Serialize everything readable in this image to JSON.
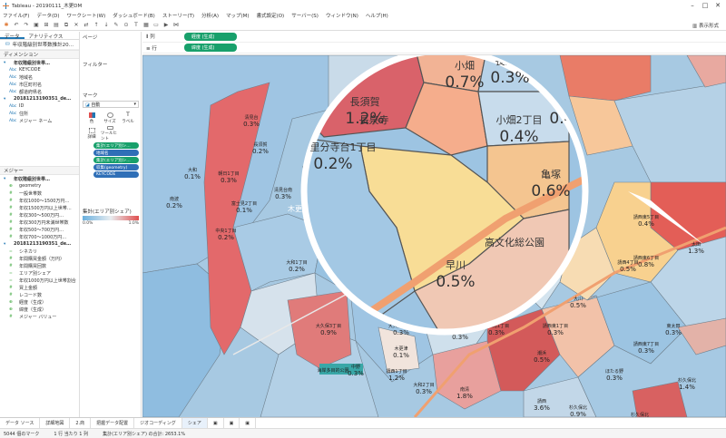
{
  "app": {
    "title": "Tableau - 20190111_木更DM"
  },
  "menu": [
    "ファイル(F)",
    "データ(D)",
    "ワークシート(W)",
    "ダッシュボード(B)",
    "ストーリー(T)",
    "分析(A)",
    "マップ(M)",
    "書式設定(O)",
    "サーバー(S)",
    "ウィンドウ(N)",
    "ヘルプ(H)"
  ],
  "toolbar": {
    "show_me": "表示形式"
  },
  "sidebar": {
    "tabs": [
      "データ",
      "アナリティクス"
    ],
    "datasource": "年収階級別世帯数推計20…",
    "dimensions_label": "ディメンション",
    "dim_groups": [
      {
        "name": "年収階級別世帯…",
        "fields": [
          {
            "icon": "Abc",
            "label": "KEYCODE"
          },
          {
            "icon": "Abc",
            "label": "地域名"
          },
          {
            "icon": "Abc",
            "label": "市区町村名"
          },
          {
            "icon": "Abc",
            "label": "都道府県名"
          }
        ]
      },
      {
        "name": "20181213190351_de…",
        "fields": [
          {
            "icon": "Abc",
            "label": "ID"
          },
          {
            "icon": "Abc",
            "label": "住所"
          },
          {
            "icon": "Abc",
            "label": "メジャー ネーム"
          }
        ]
      }
    ],
    "measures_label": "メジャー",
    "meas_groups": [
      {
        "name": "年収階級別世帯…",
        "fields": [
          {
            "icon": "⊕",
            "label": "geometry"
          },
          {
            "icon": "#",
            "label": "一般世帯数"
          },
          {
            "icon": "#",
            "label": "年収1000～1500万円…"
          },
          {
            "icon": "#",
            "label": "年収1500万円以上世帯…"
          },
          {
            "icon": "#",
            "label": "年収300～500万円…"
          },
          {
            "icon": "#",
            "label": "年収300万円未満世帯数"
          },
          {
            "icon": "#",
            "label": "年収500～700万円…"
          },
          {
            "icon": "#",
            "label": "年収700～1000万円…"
          }
        ]
      },
      {
        "name": "20181213190351_de…",
        "fields": [
          {
            "icon": "=",
            "label": "シネカリ"
          },
          {
            "icon": "#",
            "label": "年間購買金額（万円）"
          },
          {
            "icon": "#",
            "label": "年間購買回数"
          }
        ]
      },
      {
        "name": "",
        "fields": [
          {
            "icon": "=",
            "label": "エリア別シェア"
          },
          {
            "icon": "=",
            "label": "年収1000万円以上世帯割合"
          },
          {
            "icon": "#",
            "label": "買上金額"
          },
          {
            "icon": "#",
            "label": "レコード数"
          },
          {
            "icon": "⊕",
            "label": "経度（生成）"
          },
          {
            "icon": "⊕",
            "label": "緯度（生成）"
          },
          {
            "icon": "#",
            "label": "メジャー バリュー"
          }
        ]
      }
    ]
  },
  "cards": {
    "pages": "ページ",
    "filters": "フィルター",
    "marks": "マーク",
    "mark_type": "自動",
    "mark_buttons": [
      "色",
      "サイズ",
      "ラベル",
      "詳細",
      "ツールヒント"
    ],
    "pills": [
      {
        "label": "集計(エリア別シ…",
        "color": "green"
      },
      {
        "label": "地域名",
        "color": "blue"
      },
      {
        "label": "集計(エリア別シ…",
        "color": "green"
      },
      {
        "label": "収集(geometry)",
        "color": "blue"
      },
      {
        "label": "KEYCODE",
        "color": "blue"
      }
    ],
    "legend_title": "集計(エリア別シェア)",
    "legend_min": "0.0%",
    "legend_max": "1.0%"
  },
  "shelves": {
    "columns_label": "列",
    "columns_pill": "経度 (生成)",
    "rows_label": "行",
    "rows_pill": "緯度 (生成)"
  },
  "map": {
    "station": "木更津",
    "zoom_labels": [
      {
        "name": "小畑",
        "value": "0.7%"
      },
      {
        "name": "長須賀",
        "value": "0.3%"
      },
      {
        "name": "長須賀",
        "value": "1.2%"
      },
      {
        "name": "長泉寺",
        "value": ""
      },
      {
        "name": "小畑2丁目",
        "value": "0.4%"
      },
      {
        "name": "新宿",
        "value": "0.4%"
      },
      {
        "name": "久留里分寺台1丁目",
        "value": "0.2%"
      },
      {
        "name": "亀塚",
        "value": "0.6%"
      },
      {
        "name": "早川",
        "value": "0.5%"
      },
      {
        "name": "高文化総公園",
        "value": ""
      }
    ],
    "labels": [
      {
        "name": "清見台",
        "value": "0.3%"
      },
      {
        "name": "長須賀",
        "value": "0.2%"
      },
      {
        "name": "大和",
        "value": "0.1%"
      },
      {
        "name": "朝日1丁目",
        "value": "0.3%"
      },
      {
        "name": "桜井",
        "value": "0.3%"
      },
      {
        "name": "南波",
        "value": "0.2%"
      },
      {
        "name": "富士見2丁目",
        "value": "0.1%"
      },
      {
        "name": "清見台南",
        "value": "0.3%"
      },
      {
        "name": "中里3丁目",
        "value": "0.2%"
      },
      {
        "name": "請西南2丁目",
        "value": "0.2%"
      },
      {
        "name": "中尾",
        "value": "0.2%"
      },
      {
        "name": "請西3丁目",
        "value": "0.3%"
      },
      {
        "name": "中央1丁目",
        "value": "0.2%"
      },
      {
        "name": "大久保3丁目",
        "value": "0.9%"
      },
      {
        "name": "請西",
        "value": "0.3%"
      },
      {
        "name": "請西東2丁目",
        "value": "0.6%"
      },
      {
        "name": "小浜",
        "value": "0.4%"
      },
      {
        "name": "請西東4丁目",
        "value": "0.4%"
      },
      {
        "name": "大川",
        "value": "0.5%"
      },
      {
        "name": "太田",
        "value": "1.3%"
      },
      {
        "name": "請西4丁目",
        "value": "0.5%"
      },
      {
        "name": "大久保2丁目",
        "value": "0.3%"
      },
      {
        "name": "請西東5丁目",
        "value": "0.4%"
      },
      {
        "name": "東太田",
        "value": "0.3%"
      },
      {
        "name": "潮浜",
        "value": "0.5%"
      },
      {
        "name": "請西東7丁目",
        "value": "0.3%"
      },
      {
        "name": "大久保1丁目",
        "value": "0.3%"
      },
      {
        "name": "中野1丁目",
        "value": "0.3%"
      },
      {
        "name": "大和1丁目",
        "value": "0.2%"
      },
      {
        "name": "請西南1丁目",
        "value": "0.3%"
      },
      {
        "name": "ほたる野",
        "value": "0.3%"
      },
      {
        "name": "請西東1丁目",
        "value": "0.3%"
      },
      {
        "name": "請西1丁目",
        "value": "1.2%"
      },
      {
        "name": "中野",
        "value": "0.3%"
      },
      {
        "name": "木更津",
        "value": "0.1%"
      },
      {
        "name": "大和2丁目",
        "value": "0.3%"
      },
      {
        "name": "南清",
        "value": "1.8%"
      },
      {
        "name": "請西東6丁目",
        "value": "0.8%"
      },
      {
        "name": "請西",
        "value": "3.6%"
      },
      {
        "name": "杉久保北",
        "value": "0.9%"
      },
      {
        "name": "杉久保北",
        "value": "1.4%"
      },
      {
        "name": "杉久保北",
        "value": ""
      },
      {
        "name": "海岸多目的公園",
        "value": ""
      }
    ]
  },
  "bottom_tabs": [
    "データ ソース",
    "詳細地図",
    "2.商",
    "把握データ配置",
    "ジオコーディング",
    "シェア"
  ],
  "status": {
    "marks": "5044 個のマーク",
    "rows": "1 行 当たり 1 列",
    "sum": "集計(エリア別シェア) の合計: 2653.1%"
  }
}
